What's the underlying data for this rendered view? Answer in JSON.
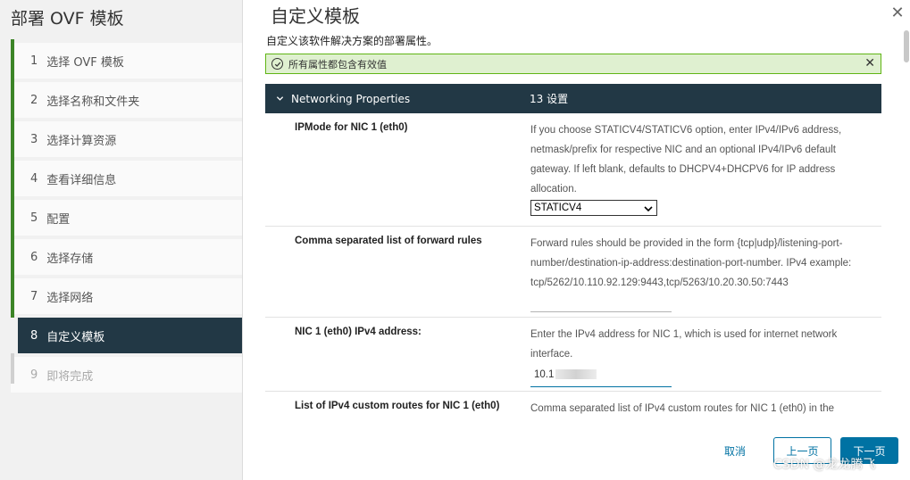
{
  "wizard": {
    "title": "部署 OVF 模板",
    "steps": [
      {
        "num": "1",
        "label": "选择 OVF 模板"
      },
      {
        "num": "2",
        "label": "选择名称和文件夹"
      },
      {
        "num": "3",
        "label": "选择计算资源"
      },
      {
        "num": "4",
        "label": "查看详细信息"
      },
      {
        "num": "5",
        "label": "配置"
      },
      {
        "num": "6",
        "label": "选择存储"
      },
      {
        "num": "7",
        "label": "选择网络"
      },
      {
        "num": "8",
        "label": "自定义模板"
      },
      {
        "num": "9",
        "label": "即将完成"
      }
    ]
  },
  "main": {
    "title": "自定义模板",
    "subtitle": "自定义该软件解决方案的部署属性。",
    "alert": "所有属性都包含有效值",
    "section": {
      "name": "Networking Properties",
      "count": "13 设置"
    },
    "rows": [
      {
        "label": "IPMode for NIC 1 (eth0)",
        "desc": "If you choose STATICV4/STATICV6 option, enter IPv4/IPv6 address, netmask/prefix for respective NIC and an optional IPv4/IPv6 default gateway. If left blank, defaults to DHCPV4+DHCPV6 for IP address allocation.",
        "value": "STATICV4"
      },
      {
        "label": "Comma separated list of forward rules",
        "desc": "Forward rules should be provided in the form {tcp|udp}/listening-port-number/destination-ip-address:destination-port-number. IPv4 example: tcp/5262/10.110.92.129:9443,tcp/5263/10.20.30.50:7443",
        "value": ""
      },
      {
        "label": "NIC 1 (eth0) IPv4 address:",
        "desc": "Enter the IPv4 address for NIC 1, which is used for internet network interface.",
        "value": "10.1"
      },
      {
        "label": "List of IPv4 custom routes for NIC 1 (eth0)",
        "desc": "Comma separated list of IPv4 custom routes for NIC 1 (eth0) in the"
      }
    ]
  },
  "footer": {
    "cancel": "取消",
    "back": "上一页",
    "next": "下一页",
    "watermark": "CSDN @龙龙腾飞"
  },
  "colors": {
    "accent": "#0072a3",
    "header_bg": "#223845",
    "success": "#60b515"
  }
}
